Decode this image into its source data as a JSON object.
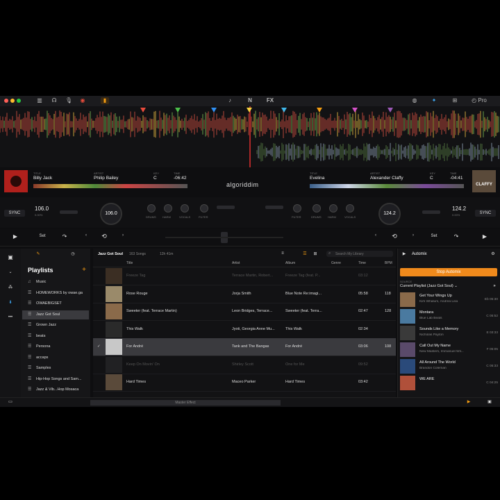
{
  "topbar": {
    "colors": {
      "close": "#ff5f57",
      "min": "#febc2e",
      "max": "#28c840"
    },
    "icons": [
      "grid-icon",
      "headphones-icon",
      "microphone-icon",
      "record-icon",
      "folder-icon",
      "artist-icon",
      "neural-mix-icon",
      "fx-icon",
      "globe-icon",
      "network-icon",
      "apps-icon",
      "pro-icon"
    ],
    "fx_label": "FX",
    "pro_label": "Pro"
  },
  "deck_left": {
    "title_label": "TITLE",
    "title": "Billy Jack",
    "artist_label": "ARTIST",
    "artist": "Philip Bailey",
    "key_label": "KEY",
    "key": "C",
    "time_label": "TIME",
    "time": "-06:42",
    "sync": "SYNC",
    "bpm": "106.0",
    "bpm_pct": "0.00%",
    "bpm_knob": "106.0",
    "set": "Set"
  },
  "deck_right": {
    "title_label": "TITLE",
    "title": "Evelina",
    "artist_label": "ARTIST",
    "artist": "Alexander Claffy",
    "key_label": "KEY",
    "key": "C",
    "time_label": "TIME",
    "time": "-04:41",
    "sync": "SYNC",
    "bpm": "124.2",
    "bpm_pct": "0.00%",
    "bpm_knob": "124.2",
    "set": "Set",
    "cover_text": "CLAFFY"
  },
  "logo": "algoriddim",
  "mixer_labels": [
    "DRUMS",
    "HARM",
    "VOCALS",
    "FILTER",
    "FILTER",
    "DRUMS",
    "HARM",
    "VOCALS"
  ],
  "cue_colors": [
    "#e84b3c",
    "#4cbf4a",
    "#2f8ff2",
    "#f4d03f",
    "#3fb6e8",
    "#f39c12",
    "#d452c7",
    "#9b59b6"
  ],
  "sidebar": {
    "heading": "Playlists",
    "items": [
      {
        "label": "Music",
        "icon": "music-icon"
      },
      {
        "label": "HOMEWORKS by owae.ga",
        "icon": "playlist-icon"
      },
      {
        "label": "OWAEBIGSET",
        "icon": "playlist-icon"
      },
      {
        "label": "Jazz Got Soul",
        "icon": "playlist-icon",
        "selected": true
      },
      {
        "label": "Grown Jazz",
        "icon": "playlist-icon"
      },
      {
        "label": "beats",
        "icon": "playlist-icon"
      },
      {
        "label": "Persona",
        "icon": "playlist-icon"
      },
      {
        "label": "accaps",
        "icon": "playlist-icon"
      },
      {
        "label": "Samples",
        "icon": "playlist-icon"
      },
      {
        "label": "Hip-Hop Songs and Sam...",
        "icon": "playlist-icon"
      },
      {
        "label": "Jazz & Vib...Hop Mosaca",
        "icon": "playlist-icon"
      }
    ]
  },
  "library": {
    "playlist": "Jazz Got Soul",
    "count": "163 Songs",
    "duration": "12h 41m",
    "search_placeholder": "Search My Library",
    "headers": {
      "title": "Title",
      "artist": "Artist",
      "album": "Album",
      "genre": "Genre",
      "time": "Time",
      "bpm": "BPM"
    },
    "rows": [
      {
        "title": "Freeze Tag",
        "artist": "Terrace Martin, Robert...",
        "album": "Freeze Tag (feat. P...",
        "time": "03:12",
        "bpm": "",
        "dim": true
      },
      {
        "title": "Rose Rouge",
        "artist": "Jorja Smith",
        "album": "Blue Note Re:imagi...",
        "time": "05:58",
        "bpm": "118"
      },
      {
        "title": "Sweeter (feat. Terrace Martin)",
        "artist": "Leon Bridges, Terrace...",
        "album": "Sweeter (feat. Terra...",
        "time": "02:47",
        "bpm": "128"
      },
      {
        "title": "This Walk",
        "artist": "Jyoti, Georgia Anne Mu...",
        "album": "This Walk",
        "time": "02:34",
        "bpm": ""
      },
      {
        "title": "For André",
        "artist": "Tank and The Bangas",
        "album": "For André",
        "time": "03:06",
        "bpm": "108",
        "selected": true
      },
      {
        "title": "Keep On Movin' On",
        "artist": "Shirley Scott",
        "album": "One for Me",
        "time": "09:52",
        "bpm": "",
        "dim": true
      },
      {
        "title": "Hard Times",
        "artist": "Maceo Parker",
        "album": "Hard Times",
        "time": "03:42",
        "bpm": ""
      }
    ]
  },
  "automix": {
    "title": "Automix",
    "stop_label": "Stop Automix",
    "source_label": "SOURCE",
    "source": "Current Playlist (Jazz Got Soul)",
    "items": [
      {
        "title": "Get Your Wings Up",
        "artist": "Kirk Whalum, Andréa Lisa",
        "meta": "Eb 05:30"
      },
      {
        "title": "Montara",
        "artist": "Blue Lab Beats",
        "meta": "C 05:52"
      },
      {
        "title": "Sounds Like a Memory",
        "artist": "Nicholas Payton",
        "meta": "E 03:33"
      },
      {
        "title": "Call Out My Name",
        "artist": "New Masters, Immanuel Wil...",
        "meta": "F 05:05"
      },
      {
        "title": "All Around The World",
        "artist": "Brandon Coleman",
        "meta": "C 05:33"
      },
      {
        "title": "WE ARE",
        "artist": "",
        "meta": "C 04:25"
      }
    ]
  },
  "bottom": {
    "master_effect": "Master Effect"
  }
}
